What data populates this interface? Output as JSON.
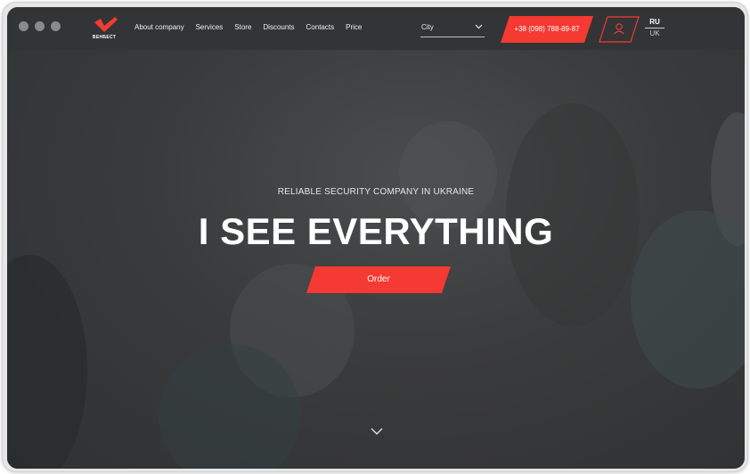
{
  "window": {
    "traffic_lights": [
      "close",
      "minimize",
      "zoom"
    ]
  },
  "header": {
    "logo_text": "ВЕНБЕСТ",
    "nav": [
      {
        "label": "About company"
      },
      {
        "label": "Services"
      },
      {
        "label": "Store"
      },
      {
        "label": "Discounts"
      },
      {
        "label": "Contacts"
      },
      {
        "label": "Price"
      }
    ],
    "city": {
      "label": "City",
      "icon": "chevron-down-icon"
    },
    "phone": {
      "label": "+38 (098) 788-89-87"
    },
    "user": {
      "icon": "user-icon"
    },
    "lang": {
      "active": "RU",
      "other": "UK"
    }
  },
  "hero": {
    "tagline": "RELIABLE SECURITY COMPANY IN UKRAINE",
    "headline": "I SEE EVERYTHING",
    "cta": "Order",
    "scroll_icon": "chevron-down-icon"
  },
  "colors": {
    "accent": "#f43a32",
    "header_bg": "#333435",
    "hero_bg": "#393a3b",
    "text": "#ffffff"
  }
}
